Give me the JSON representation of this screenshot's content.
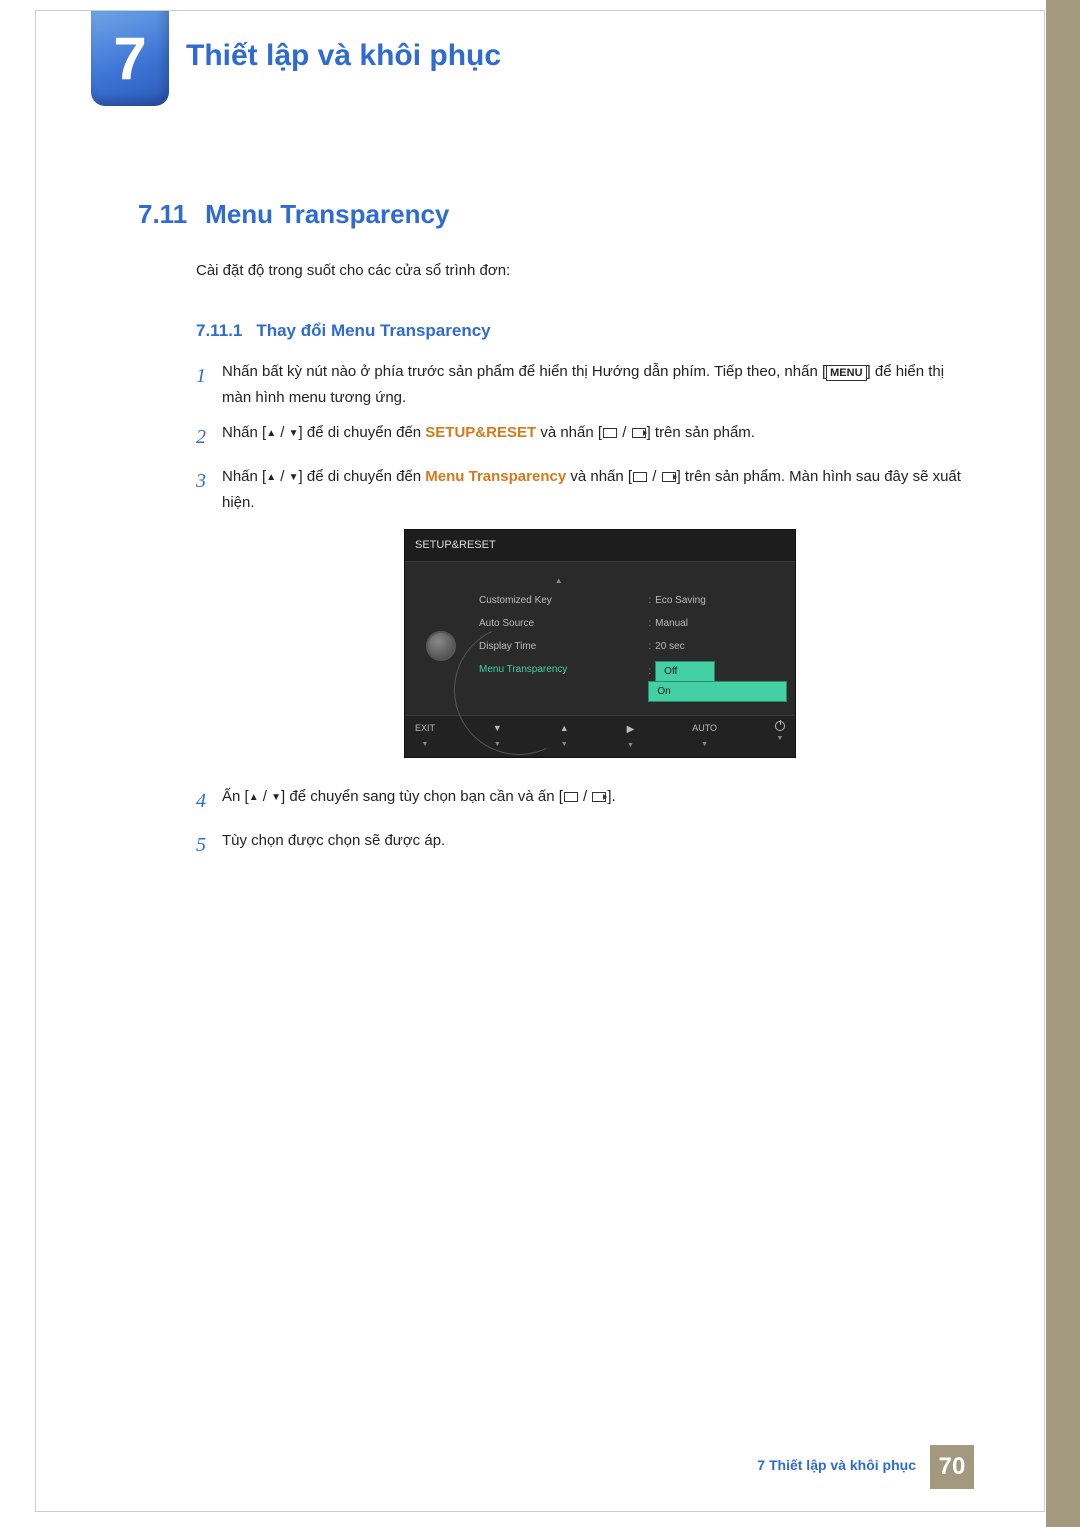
{
  "chapter": {
    "number": "7",
    "title": "Thiết lập và khôi phục"
  },
  "section": {
    "number": "7.11",
    "title": "Menu Transparency"
  },
  "intro": "Cài đặt độ trong suốt cho các cửa sổ trình đơn:",
  "subsection": {
    "number": "7.11.1",
    "title": "Thay đổi Menu Transparency"
  },
  "steps": {
    "s1": {
      "num": "1",
      "a": "Nhấn bất kỳ nút nào ở phía trước sản phẩm để hiển thị Hướng dẫn phím. Tiếp theo, nhấn [",
      "menu": "MENU",
      "b": "] để hiển thị màn hình menu tương ứng."
    },
    "s2": {
      "num": "2",
      "a": "Nhấn [",
      "b": "] để di chuyển đến ",
      "kw": "SETUP&RESET",
      "c": " và nhấn [",
      "d": "] trên sản phẩm."
    },
    "s3": {
      "num": "3",
      "a": "Nhấn [",
      "b": "] để di chuyển đến ",
      "kw": "Menu Transparency",
      "c": " và nhấn [",
      "d": "] trên sản phẩm. Màn hình sau đây sẽ xuất hiện."
    },
    "s4": {
      "num": "4",
      "a": "Ấn [",
      "b": "] để chuyển sang tùy chọn bạn cần và ấn [",
      "c": "]."
    },
    "s5": {
      "num": "5",
      "a": "Tùy chọn được chọn sẽ được áp."
    }
  },
  "osd": {
    "title": "SETUP&RESET",
    "rows": {
      "r1l": "Customized Key",
      "r1r": "Eco Saving",
      "r2l": "Auto Source",
      "r2r": "Manual",
      "r3l": "Display Time",
      "r3r": "20 sec",
      "r4l": "Menu Transparency",
      "r4ra": "Off",
      "r4rb": "On"
    },
    "footer": {
      "exit": "EXIT",
      "auto": "AUTO"
    }
  },
  "footer": {
    "label": "7 Thiết lập và khôi phục",
    "page": "70"
  }
}
